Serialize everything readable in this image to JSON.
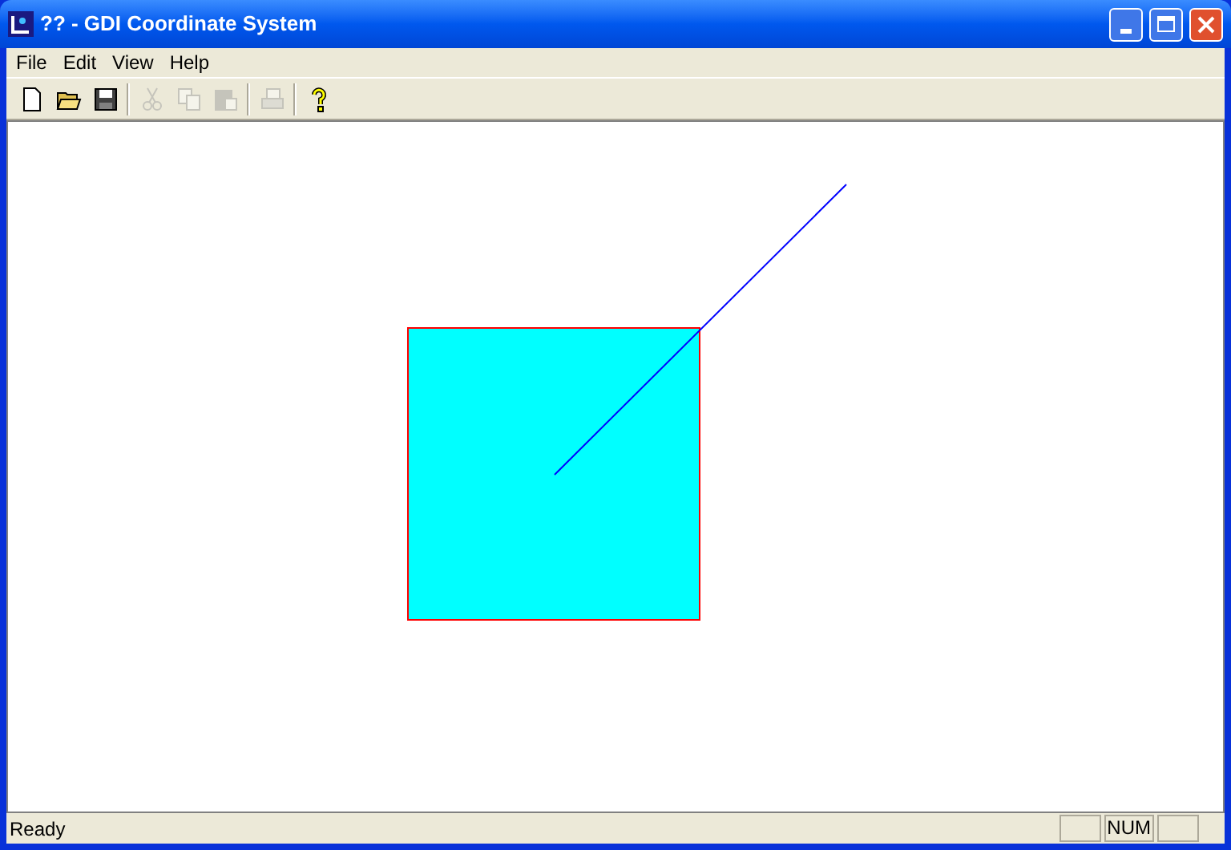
{
  "window": {
    "title": "?? - GDI Coordinate System"
  },
  "menu": [
    {
      "label": "File"
    },
    {
      "label": "Edit"
    },
    {
      "label": "View"
    },
    {
      "label": "Help"
    }
  ],
  "toolbar": [
    {
      "kind": "new",
      "disabled": false
    },
    {
      "kind": "open",
      "disabled": false
    },
    {
      "kind": "save",
      "disabled": false
    },
    {
      "kind": "separator"
    },
    {
      "kind": "cut",
      "disabled": true
    },
    {
      "kind": "copy",
      "disabled": true
    },
    {
      "kind": "paste",
      "disabled": true
    },
    {
      "kind": "separator"
    },
    {
      "kind": "print",
      "disabled": true
    },
    {
      "kind": "separator"
    },
    {
      "kind": "help",
      "disabled": false
    }
  ],
  "status_bar": {
    "text": "Ready",
    "indicator": "NUM"
  }
}
